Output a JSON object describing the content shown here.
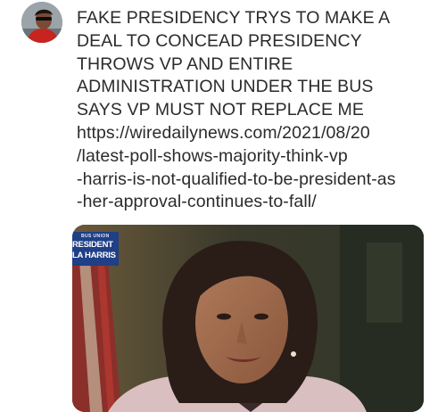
{
  "post": {
    "text_lines": [
      "FAKE PRESIDENCY TRYS TO MAKE A",
      "DEAL TO CONCEAD PRESIDENCY",
      "THROWS VP AND ENTIRE",
      "ADMINISTRATION UNDER THE BUS",
      "SAYS VP MUST NOT REPLACE ME"
    ],
    "link_lines": [
      "https://wiredailynews.com/2021/08/20",
      "/latest-poll-shows-majority-think-vp",
      "-harris-is-not-qualified-to-be-president-as",
      "-her-approval-continues-to-fall/"
    ]
  },
  "media": {
    "chyron": {
      "tag": "BUS UNION",
      "line1": "RESIDENT",
      "line2": "LA HARRIS"
    }
  },
  "colors": {
    "text": "#2b2b2b",
    "chyron_bg": "#1f3f86",
    "background": "#ffffff"
  },
  "icons": {
    "avatar": "profile-avatar"
  }
}
